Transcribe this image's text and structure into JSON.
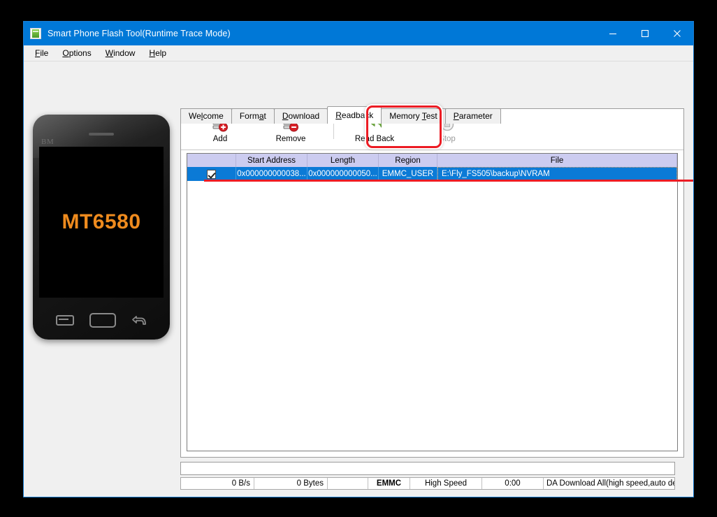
{
  "window": {
    "title": "Smart Phone Flash Tool(Runtime Trace Mode)",
    "icon": "flash-tool-icon",
    "minimize_label": "Minimize",
    "maximize_label": "Maximize",
    "close_label": "Close"
  },
  "menu": [
    {
      "label": "File",
      "mnemonic": "F"
    },
    {
      "label": "Options",
      "mnemonic": "O"
    },
    {
      "label": "Window",
      "mnemonic": "W"
    },
    {
      "label": "Help",
      "mnemonic": "H"
    }
  ],
  "device_preview": {
    "watermark": "BM",
    "chipset": "MT6580",
    "chipset_color": "#ef8b1e",
    "nav_buttons": [
      "menu-button",
      "home-button",
      "back-button"
    ]
  },
  "tabs": [
    {
      "label": "Welcome",
      "mnemonic": "l",
      "active": false
    },
    {
      "label": "Format",
      "mnemonic": "a",
      "active": false
    },
    {
      "label": "Download",
      "mnemonic": "D",
      "active": false
    },
    {
      "label": "Readback",
      "mnemonic": "R",
      "active": true
    },
    {
      "label": "Memory Test",
      "mnemonic": "T",
      "active": false
    },
    {
      "label": "Parameter",
      "mnemonic": "P",
      "active": false
    }
  ],
  "toolbar": {
    "add_label": "Add",
    "remove_label": "Remove",
    "readback_label": "Read Back",
    "stop_label": "Stop",
    "stop_disabled": true,
    "highlight_color": "#ec1c24"
  },
  "table": {
    "columns": [
      "",
      "Start Address",
      "Length",
      "Region",
      "File"
    ],
    "rows": [
      {
        "checked": true,
        "start_address": "0x000000000038...",
        "length": "0x000000000050...",
        "region": "EMMC_USER",
        "file": "E:\\Fly_FS505\\backup\\NVRAM",
        "selected": true
      }
    ],
    "header_color": "#ccccf0",
    "selection_color": "#0b7ad6"
  },
  "progress": {
    "value": 0
  },
  "statusbar": {
    "speed": "0 B/s",
    "bytes": "0 Bytes",
    "spacer": "",
    "storage": "EMMC",
    "usb_speed": "High Speed",
    "elapsed": "0:00",
    "connection": "USB: DA Download All(high speed,auto detect)"
  }
}
